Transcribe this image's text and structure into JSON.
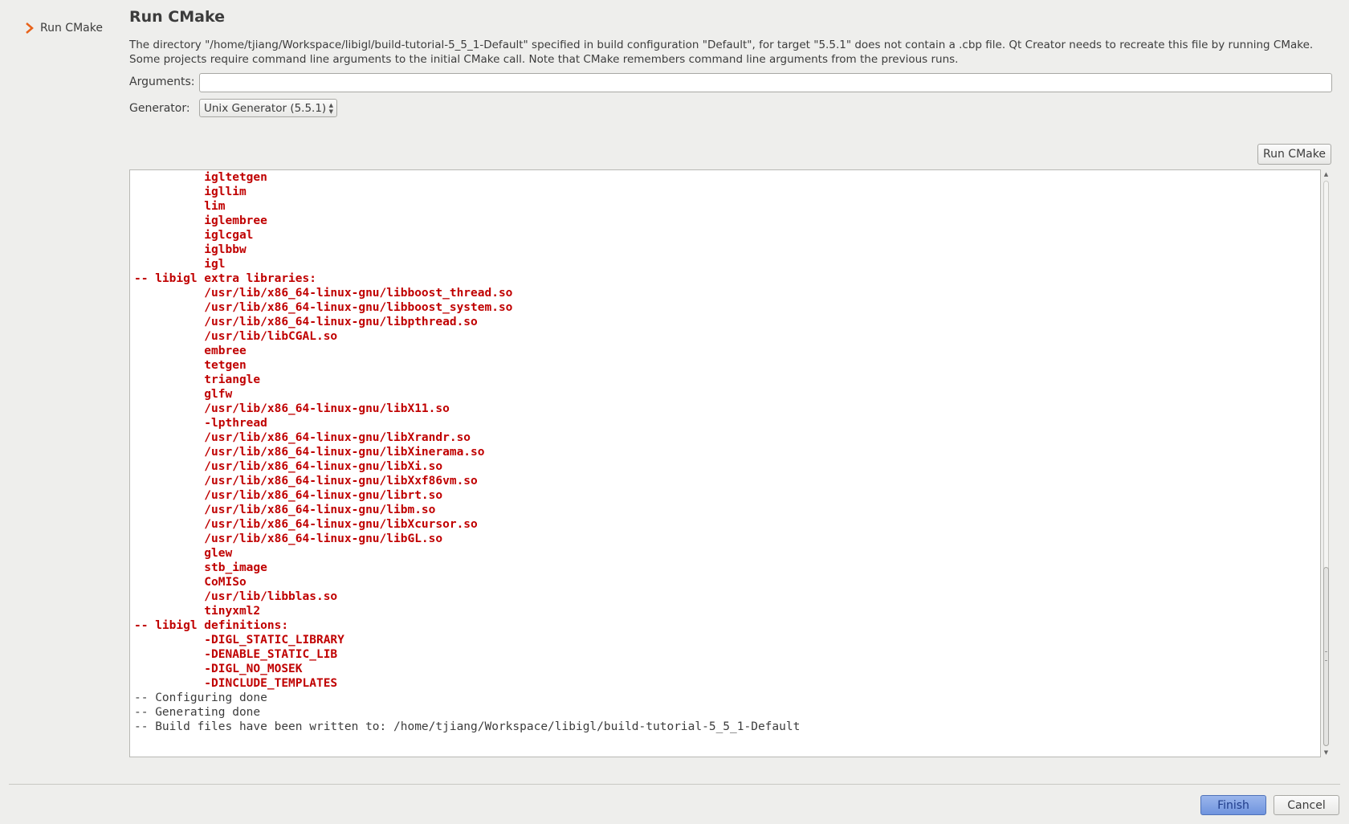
{
  "sidebar": {
    "items": [
      {
        "label": "Run CMake",
        "icon": "chevron-right-icon",
        "icon_color": "#e8621a"
      }
    ]
  },
  "page": {
    "title": "Run CMake",
    "description_line1": "The directory \"/home/tjiang/Workspace/libigl/build-tutorial-5_5_1-Default\" specified in build configuration \"Default\", for target \"5.5.1\" does not contain a .cbp file. Qt Creator needs to recreate this file by running CMake.",
    "description_line2": "Some projects require command line arguments to the initial CMake call. Note that CMake remembers command line arguments from the previous runs."
  },
  "form": {
    "arguments_label": "Arguments:",
    "arguments_value": "",
    "generator_label": "Generator:",
    "generator_value": "Unix Generator (5.5.1)"
  },
  "run_button": {
    "label": "Run CMake"
  },
  "output": {
    "colors": {
      "error": "#c00000",
      "normal": "#3c3c3c"
    },
    "lines": [
      {
        "text": "          igltetgen",
        "style": "err"
      },
      {
        "text": "          igllim",
        "style": "err"
      },
      {
        "text": "          lim",
        "style": "err"
      },
      {
        "text": "          iglembree",
        "style": "err"
      },
      {
        "text": "          iglcgal",
        "style": "err"
      },
      {
        "text": "          iglbbw",
        "style": "err"
      },
      {
        "text": "          igl",
        "style": "err"
      },
      {
        "text": "-- libigl extra libraries:",
        "style": "err"
      },
      {
        "text": "          /usr/lib/x86_64-linux-gnu/libboost_thread.so",
        "style": "err"
      },
      {
        "text": "          /usr/lib/x86_64-linux-gnu/libboost_system.so",
        "style": "err"
      },
      {
        "text": "          /usr/lib/x86_64-linux-gnu/libpthread.so",
        "style": "err"
      },
      {
        "text": "          /usr/lib/libCGAL.so",
        "style": "err"
      },
      {
        "text": "          embree",
        "style": "err"
      },
      {
        "text": "          tetgen",
        "style": "err"
      },
      {
        "text": "          triangle",
        "style": "err"
      },
      {
        "text": "          glfw",
        "style": "err"
      },
      {
        "text": "          /usr/lib/x86_64-linux-gnu/libX11.so",
        "style": "err"
      },
      {
        "text": "          -lpthread",
        "style": "err"
      },
      {
        "text": "          /usr/lib/x86_64-linux-gnu/libXrandr.so",
        "style": "err"
      },
      {
        "text": "          /usr/lib/x86_64-linux-gnu/libXinerama.so",
        "style": "err"
      },
      {
        "text": "          /usr/lib/x86_64-linux-gnu/libXi.so",
        "style": "err"
      },
      {
        "text": "          /usr/lib/x86_64-linux-gnu/libXxf86vm.so",
        "style": "err"
      },
      {
        "text": "          /usr/lib/x86_64-linux-gnu/librt.so",
        "style": "err"
      },
      {
        "text": "          /usr/lib/x86_64-linux-gnu/libm.so",
        "style": "err"
      },
      {
        "text": "          /usr/lib/x86_64-linux-gnu/libXcursor.so",
        "style": "err"
      },
      {
        "text": "          /usr/lib/x86_64-linux-gnu/libGL.so",
        "style": "err"
      },
      {
        "text": "          glew",
        "style": "err"
      },
      {
        "text": "          stb_image",
        "style": "err"
      },
      {
        "text": "          CoMISo",
        "style": "err"
      },
      {
        "text": "          /usr/lib/libblas.so",
        "style": "err"
      },
      {
        "text": "          tinyxml2",
        "style": "err"
      },
      {
        "text": "-- libigl definitions:",
        "style": "err"
      },
      {
        "text": "          -DIGL_STATIC_LIBRARY",
        "style": "err"
      },
      {
        "text": "          -DENABLE_STATIC_LIB",
        "style": "err"
      },
      {
        "text": "          -DIGL_NO_MOSEK",
        "style": "err"
      },
      {
        "text": "          -DINCLUDE_TEMPLATES",
        "style": "err"
      },
      {
        "text": "-- Configuring done",
        "style": "info"
      },
      {
        "text": "-- Generating done",
        "style": "info"
      },
      {
        "text": "-- Build files have been written to: /home/tjiang/Workspace/libigl/build-tutorial-5_5_1-Default",
        "style": "info"
      }
    ]
  },
  "footer": {
    "finish_label": "Finish",
    "cancel_label": "Cancel",
    "finish_color": "#7699e0"
  }
}
